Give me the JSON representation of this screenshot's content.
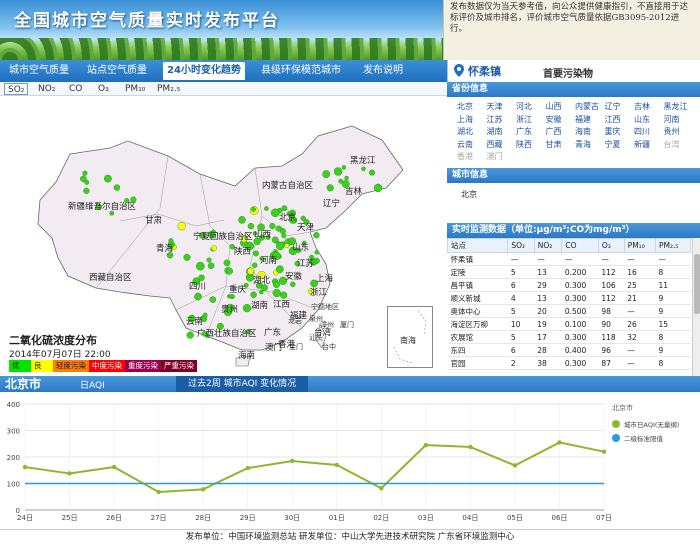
{
  "header": {
    "title": "全国城市空气质量实时发布平台",
    "notice": "发布数据仅为当天参考值，向公众提供健康指引，不直接用于达标评价及城市排名，评价城市空气质量依据GB3095-2012进行。"
  },
  "nav": {
    "items": [
      "城市空气质量",
      "站点空气质量",
      "24小时变化趋势",
      "县级环保模范城市",
      "发布说明"
    ],
    "active_index": 2,
    "station_name": "怀柔镇",
    "primary_pollutant": "首要污染物"
  },
  "pollutant_tabs": [
    "SO₂",
    "NO₂",
    "CO",
    "O₃",
    "PM₁₀",
    "PM₂.₅"
  ],
  "map": {
    "title": "二氧化硫浓度分布",
    "datetime": "2014年07月07日 22:00",
    "south_sea": "南海",
    "provinces": [
      {
        "name": "黑龙江",
        "x": 350,
        "y": 64
      },
      {
        "name": "吉林",
        "x": 345,
        "y": 95
      },
      {
        "name": "内蒙古自治区",
        "x": 262,
        "y": 89
      },
      {
        "name": "辽宁",
        "x": 323,
        "y": 107
      },
      {
        "name": "新疆维吾尔自治区",
        "x": 68,
        "y": 110
      },
      {
        "name": "北京",
        "x": 279,
        "y": 121
      },
      {
        "name": "天津",
        "x": 297,
        "y": 131
      },
      {
        "name": "甘肃",
        "x": 145,
        "y": 124
      },
      {
        "name": "宁夏回族自治区",
        "x": 193,
        "y": 140
      },
      {
        "name": "山西",
        "x": 254,
        "y": 138
      },
      {
        "name": "山东",
        "x": 292,
        "y": 151
      },
      {
        "name": "青海",
        "x": 156,
        "y": 152
      },
      {
        "name": "陕西",
        "x": 234,
        "y": 155
      },
      {
        "name": "河南",
        "x": 260,
        "y": 164
      },
      {
        "name": "江苏",
        "x": 297,
        "y": 167
      },
      {
        "name": "西藏自治区",
        "x": 89,
        "y": 181
      },
      {
        "name": "安徽",
        "x": 285,
        "y": 180
      },
      {
        "name": "上海",
        "x": 316,
        "y": 182
      },
      {
        "name": "四川",
        "x": 189,
        "y": 190
      },
      {
        "name": "湖北",
        "x": 253,
        "y": 184
      },
      {
        "name": "重庆",
        "x": 229,
        "y": 193
      },
      {
        "name": "浙江",
        "x": 310,
        "y": 196
      },
      {
        "name": "湖南",
        "x": 251,
        "y": 209
      },
      {
        "name": "江西",
        "x": 273,
        "y": 208
      },
      {
        "name": "贵州",
        "x": 221,
        "y": 213
      },
      {
        "name": "福建",
        "x": 290,
        "y": 219
      },
      {
        "name": "云南",
        "x": 186,
        "y": 225
      },
      {
        "name": "广西壮族自治区",
        "x": 197,
        "y": 237
      },
      {
        "name": "广东",
        "x": 264,
        "y": 236
      },
      {
        "name": "台湾",
        "x": 314,
        "y": 236
      },
      {
        "name": "香港",
        "x": 278,
        "y": 248
      },
      {
        "name": "澳门",
        "x": 265,
        "y": 251
      },
      {
        "name": "海南",
        "x": 238,
        "y": 259
      }
    ],
    "cities": [
      {
        "name": "宁德地区",
        "x": 311,
        "y": 210
      },
      {
        "name": "龙岩",
        "x": 288,
        "y": 224
      },
      {
        "name": "泉州",
        "x": 309,
        "y": 222
      },
      {
        "name": "漳州",
        "x": 320,
        "y": 228
      },
      {
        "name": "厦门",
        "x": 340,
        "y": 228
      },
      {
        "name": "汕头",
        "x": 309,
        "y": 241
      },
      {
        "name": "金门",
        "x": 289,
        "y": 250
      },
      {
        "name": "台中",
        "x": 322,
        "y": 250
      }
    ],
    "legend": [
      {
        "label": "优",
        "color": "#00e400"
      },
      {
        "label": "良",
        "color": "#ffff00"
      },
      {
        "label": "轻度污染",
        "color": "#ff7e00"
      },
      {
        "label": "中度污染",
        "color": "#ff0000"
      },
      {
        "label": "重度污染",
        "color": "#99004c"
      },
      {
        "label": "严重污染",
        "color": "#7e0023"
      }
    ]
  },
  "province_panel": {
    "title": "省份信息",
    "rows": [
      [
        "北京",
        "天津",
        "河北",
        "山西",
        "内蒙古",
        "辽宁",
        "吉林",
        "黑龙江"
      ],
      [
        "上海",
        "江苏",
        "浙江",
        "安徽",
        "福建",
        "江西",
        "山东",
        "河南"
      ],
      [
        "湖北",
        "湖南",
        "广东",
        "广西",
        "海南",
        "重庆",
        "四川",
        "贵州"
      ],
      [
        "云南",
        "西藏",
        "陕西",
        "甘肃",
        "青海",
        "宁夏",
        "新疆",
        "台湾"
      ],
      [
        "香港",
        "澳门"
      ]
    ],
    "dim": [
      "台湾",
      "香港",
      "澳门"
    ]
  },
  "city_panel": {
    "title": "城市信息",
    "city": "北京"
  },
  "station_table": {
    "title": "实时监测数据（单位:μg/m³;CO为mg/m³）",
    "headers": [
      "站点",
      "SO₂",
      "NO₂",
      "CO",
      "O₃",
      "PM₁₀",
      "PM₂.₅"
    ],
    "rows": [
      [
        "怀柔镇",
        "—",
        "—",
        "—",
        "—",
        "—",
        "—"
      ],
      [
        "定陵",
        "5",
        "13",
        "0.200",
        "112",
        "16",
        "8"
      ],
      [
        "昌平镇",
        "6",
        "29",
        "0.300",
        "106",
        "25",
        "11"
      ],
      [
        "顺义新城",
        "4",
        "13",
        "0.300",
        "112",
        "21",
        "9"
      ],
      [
        "奥体中心",
        "5",
        "20",
        "0.500",
        "98",
        "—",
        "9"
      ],
      [
        "海淀区万柳",
        "10",
        "19",
        "0.100",
        "90",
        "26",
        "15"
      ],
      [
        "农展馆",
        "5",
        "17",
        "0.300",
        "118",
        "32",
        "8"
      ],
      [
        "东四",
        "6",
        "28",
        "0.400",
        "96",
        "—",
        "9"
      ],
      [
        "官园",
        "2",
        "38",
        "0.300",
        "87",
        "—",
        "8"
      ]
    ]
  },
  "bottom_bar": {
    "city": "北京市",
    "metric": "日AQI",
    "trend_title": "过去2周 城市AQI 变化情况"
  },
  "chart_data": {
    "type": "line",
    "x": [
      "24日",
      "25日",
      "26日",
      "27日",
      "28日",
      "29日",
      "30日",
      "01日",
      "02日",
      "03日",
      "04日",
      "05日",
      "06日",
      "07日"
    ],
    "series": [
      {
        "name": "城市日AQI(无量纲)",
        "color": "#8db82e",
        "values": [
          162,
          138,
          162,
          68,
          78,
          158,
          185,
          170,
          82,
          245,
          238,
          168,
          255,
          220
        ]
      },
      {
        "name": "二级标准限值",
        "color": "#2a9ad8",
        "values": [
          100,
          100,
          100,
          100,
          100,
          100,
          100,
          100,
          100,
          100,
          100,
          100,
          100,
          100
        ]
      }
    ],
    "legend_title": "北京市",
    "yticks": [
      0,
      100,
      200,
      300,
      400
    ],
    "ylim": [
      0,
      400
    ],
    "grid": true,
    "legend_position": "right"
  },
  "footer": "发布单位：中国环境监测总站    研发单位：中山大学先进技术研究院 广东省环境监测中心"
}
